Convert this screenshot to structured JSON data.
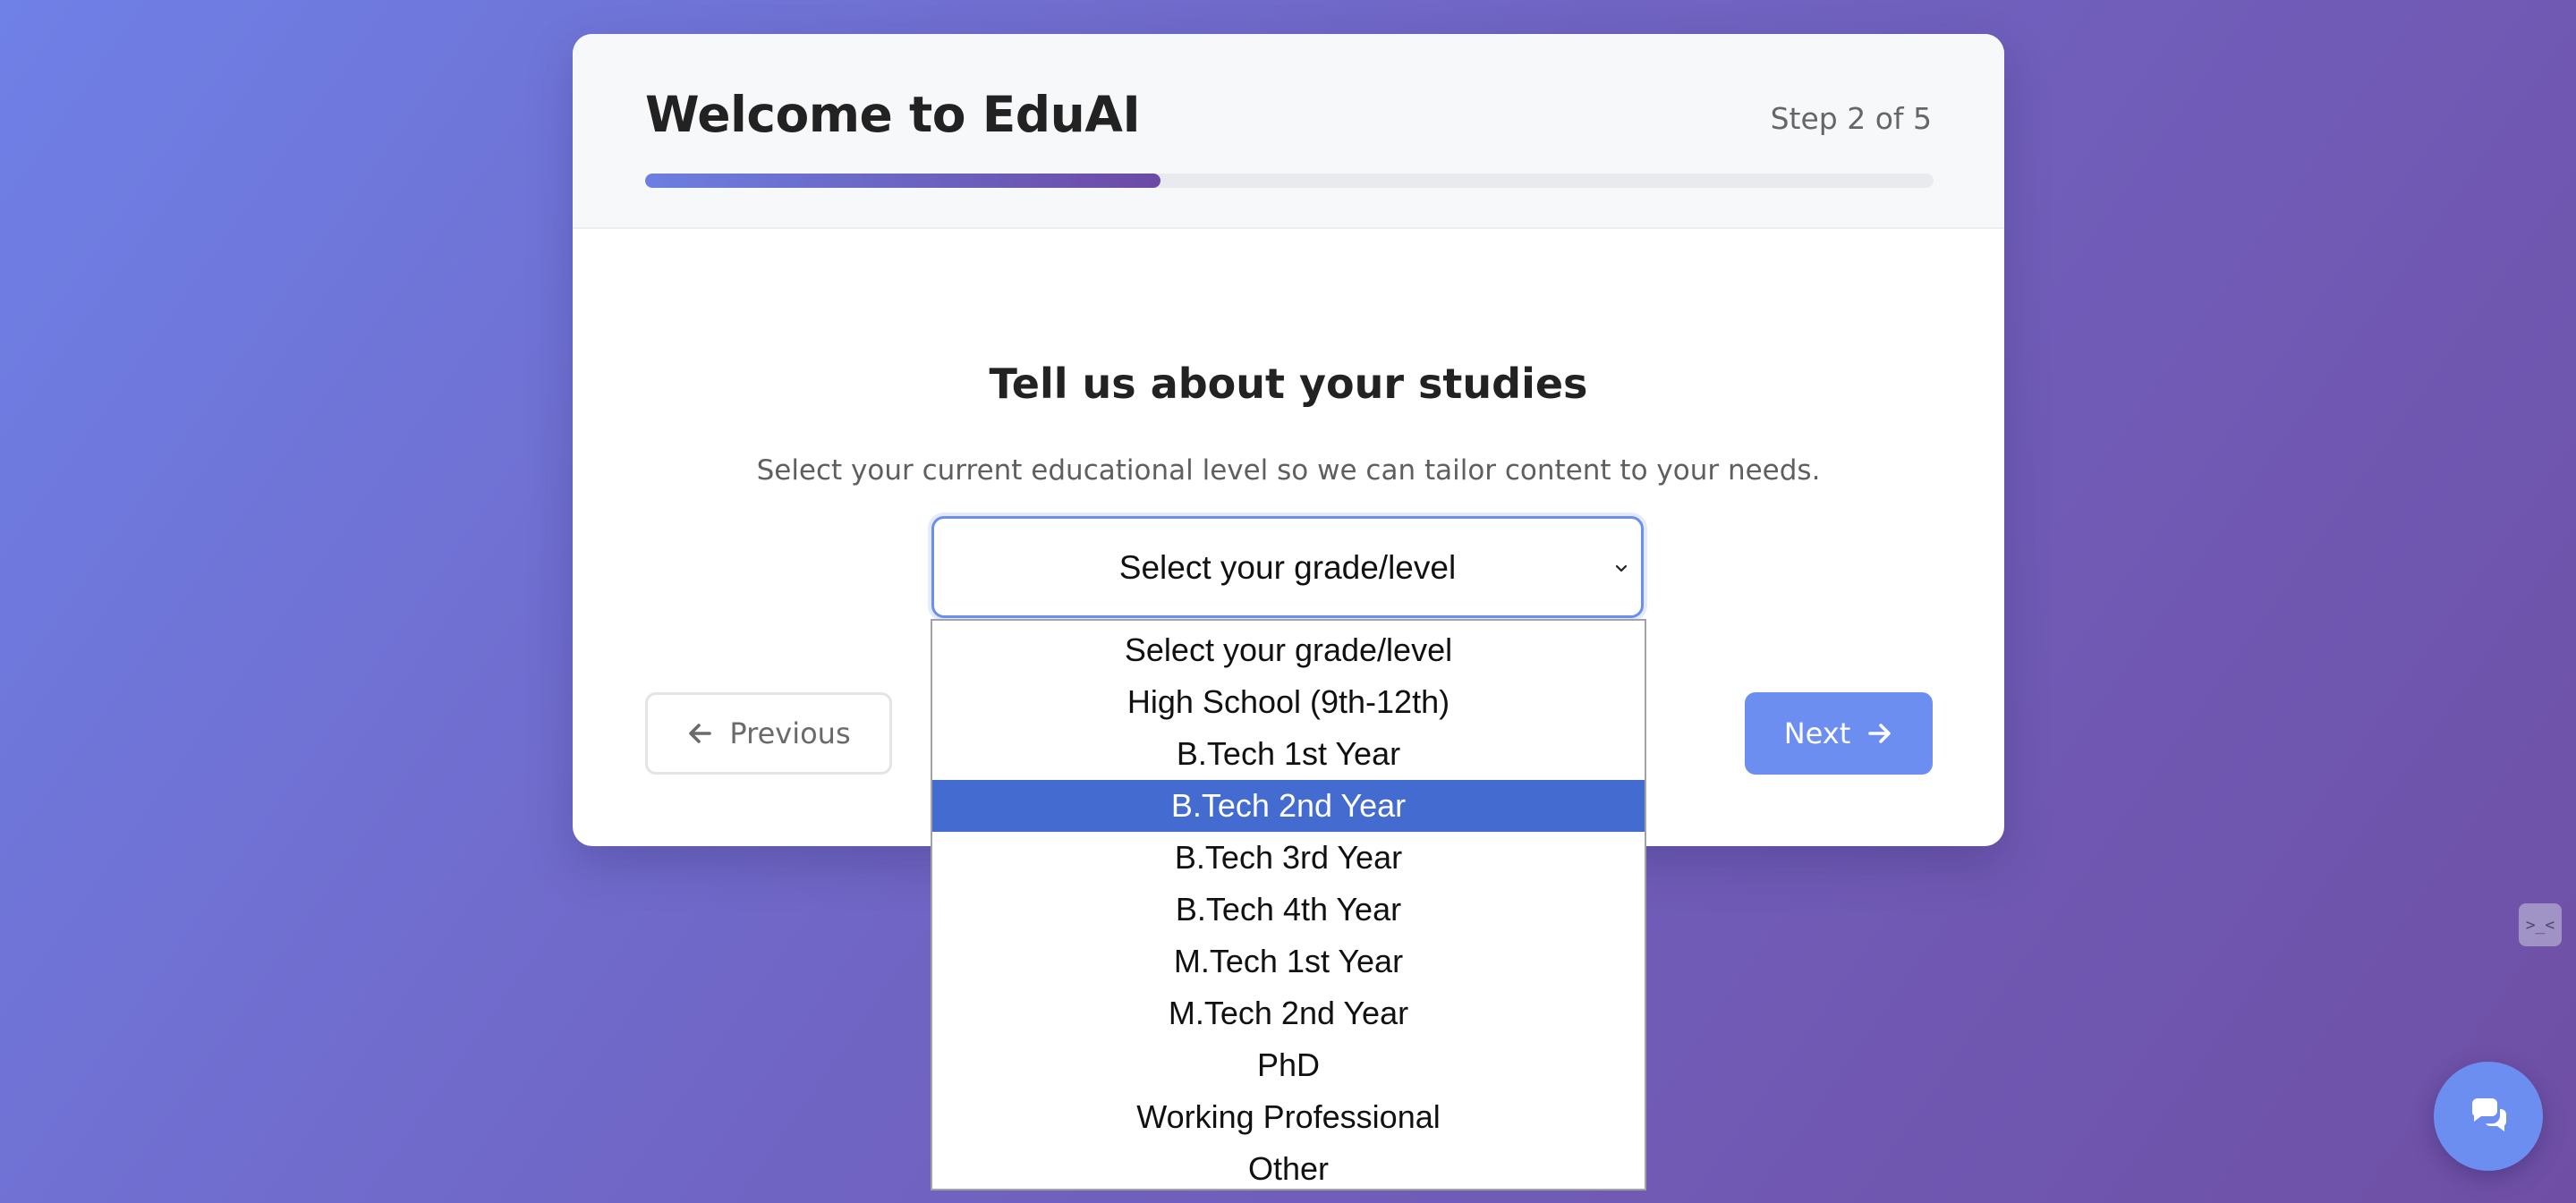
{
  "header": {
    "title": "Welcome to EduAI",
    "step_label": "Step 2 of 5",
    "progress_fraction": 0.4
  },
  "section": {
    "title": "Tell us about your studies",
    "description": "Select your current educational level so we can tailor content to your needs."
  },
  "grade_select": {
    "value": "Select your grade/level",
    "options": [
      "Select your grade/level",
      "High School (9th-12th)",
      "B.Tech 1st Year",
      "B.Tech 2nd Year",
      "B.Tech 3rd Year",
      "B.Tech 4th Year",
      "M.Tech 1st Year",
      "M.Tech 2nd Year",
      "PhD",
      "Working Professional",
      "Other"
    ],
    "highlighted_option": "B.Tech 2nd Year"
  },
  "nav": {
    "previous_label": "Previous",
    "next_label": "Next"
  },
  "devtools": {
    "badge_text": ">_<"
  },
  "colors": {
    "accent": "#6b8ef0",
    "highlight": "#436bd0",
    "progress_start": "#6c7fe0",
    "progress_end": "#6c4aa6"
  },
  "icons": {
    "previous": "arrow-left-icon",
    "next": "arrow-right-icon",
    "select": "chevron-down-icon",
    "chat": "chat-bubbles-icon"
  }
}
